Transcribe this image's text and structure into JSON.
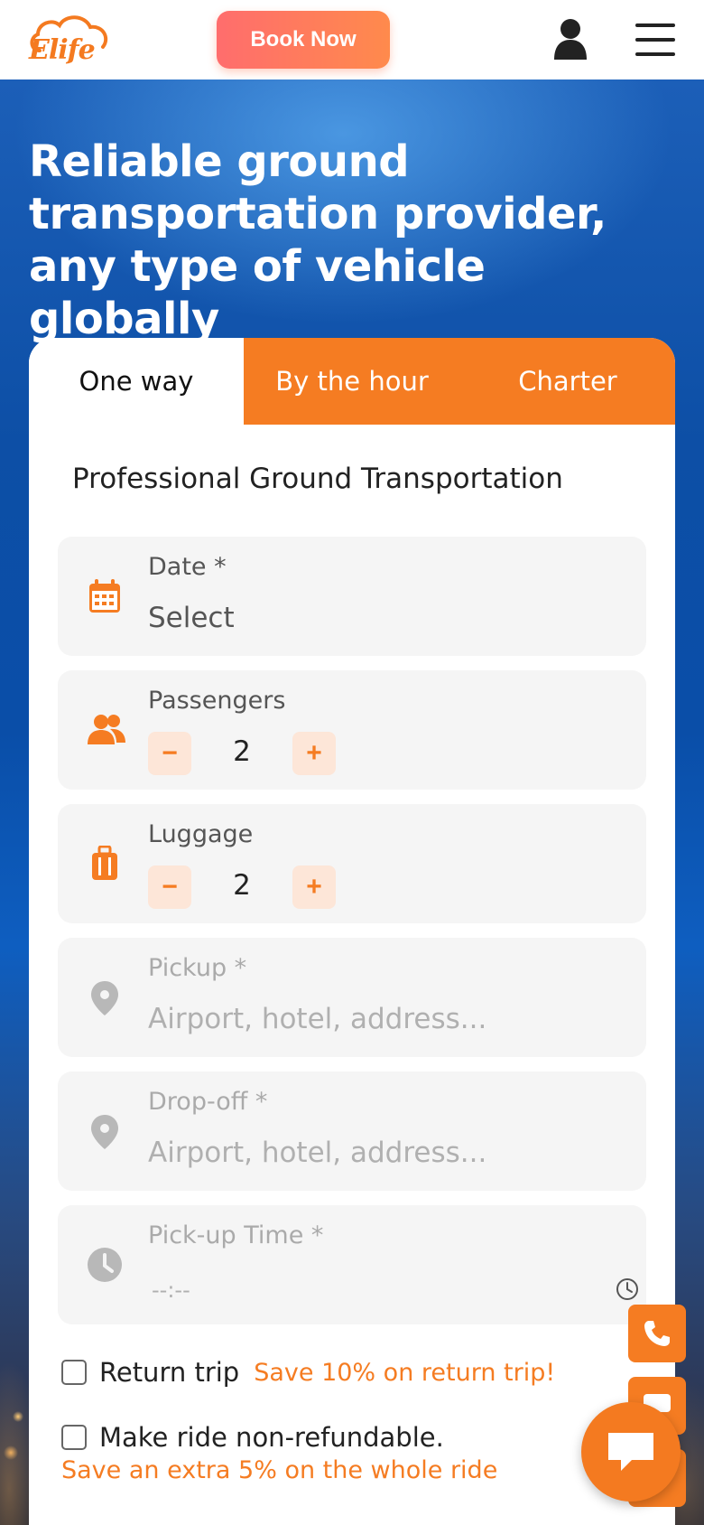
{
  "header": {
    "logo_text": "Elife",
    "book_button": "Book Now"
  },
  "hero": {
    "title": "Reliable ground transportation provider, any type of vehicle globally"
  },
  "tabs": [
    {
      "label": "One way",
      "active": true
    },
    {
      "label": "By the hour",
      "active": false
    },
    {
      "label": "Charter",
      "active": false
    }
  ],
  "form": {
    "heading": "Professional Ground Transportation",
    "date": {
      "label": "Date *",
      "value": "Select"
    },
    "passengers": {
      "label": "Passengers",
      "value": "2",
      "minus": "−",
      "plus": "+"
    },
    "luggage": {
      "label": "Luggage",
      "value": "2",
      "minus": "−",
      "plus": "+"
    },
    "pickup": {
      "label": "Pickup *",
      "placeholder": "Airport, hotel, address..."
    },
    "dropoff": {
      "label": "Drop-off *",
      "placeholder": "Airport, hotel, address..."
    },
    "pickup_time": {
      "label": "Pick-up Time *",
      "value": "--:--"
    },
    "return_trip": {
      "label": "Return trip",
      "promo": "Save 10% on return trip!",
      "checked": false
    },
    "non_refundable": {
      "label": "Make ride non-refundable.",
      "promo": "Save an extra 5% on the whole ride",
      "checked": false
    }
  },
  "colors": {
    "accent": "#f57c22",
    "book_gradient_start": "#ff6d6d",
    "book_gradient_end": "#ff8a4c"
  },
  "icons": [
    "cloud-logo-icon",
    "user-icon",
    "hamburger-menu-icon",
    "calendar-icon",
    "people-icon",
    "luggage-icon",
    "location-pin-icon",
    "clock-icon",
    "phone-icon",
    "chat-icon"
  ]
}
